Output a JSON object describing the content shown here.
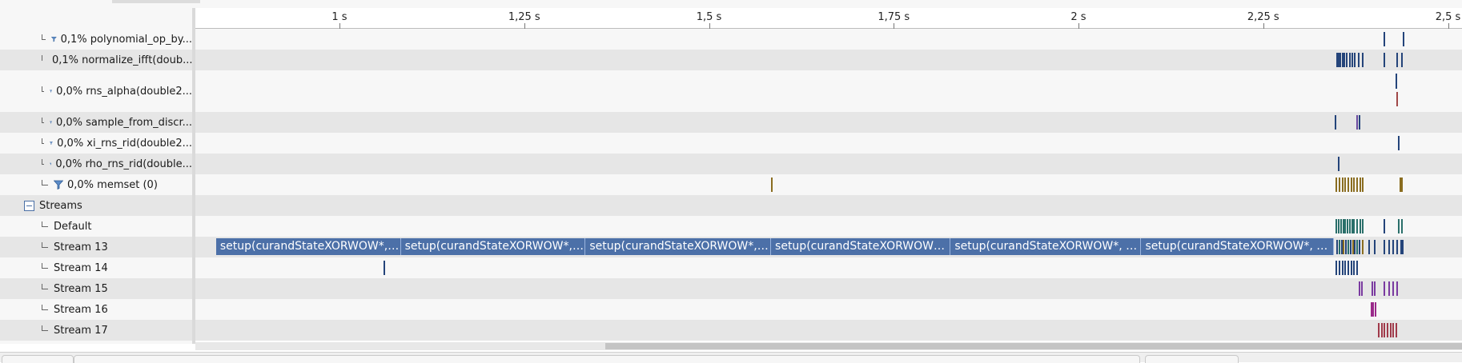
{
  "timeline": {
    "ticks": [
      {
        "label": "1 s",
        "t": 1.0
      },
      {
        "label": "1,25 s",
        "t": 1.25
      },
      {
        "label": "1,5 s",
        "t": 1.5
      },
      {
        "label": "1,75 s",
        "t": 1.75
      },
      {
        "label": "2 s",
        "t": 2.0
      },
      {
        "label": "2,25 s",
        "t": 2.25
      },
      {
        "label": "2,5 s",
        "t": 2.5
      }
    ]
  },
  "rows": [
    {
      "kind": "kernel",
      "label": "0,1% polynomial_op_by...",
      "marks": [
        {
          "t": 2.4125,
          "color": "#24447a"
        },
        {
          "t": 2.4385,
          "color": "#24447a"
        }
      ]
    },
    {
      "kind": "kernel",
      "label": "0,1% normalize_ifft(doub...",
      "marks": [
        {
          "t": 2.349,
          "color": "#24447a"
        },
        {
          "t": 2.351,
          "color": "#24447a"
        },
        {
          "t": 2.353,
          "color": "#24447a"
        },
        {
          "t": 2.356,
          "color": "#24447a"
        },
        {
          "t": 2.359,
          "color": "#24447a"
        },
        {
          "t": 2.362,
          "color": "#24447a"
        },
        {
          "t": 2.366,
          "color": "#24447a"
        },
        {
          "t": 2.369,
          "color": "#24447a"
        },
        {
          "t": 2.373,
          "color": "#24447a"
        },
        {
          "t": 2.378,
          "color": "#24447a"
        },
        {
          "t": 2.383,
          "color": "#24447a"
        },
        {
          "t": 2.4125,
          "color": "#24447a"
        },
        {
          "t": 2.43,
          "color": "#24447a"
        },
        {
          "t": 2.437,
          "color": "#24447a"
        }
      ]
    },
    {
      "kind": "kernel",
      "label": "0,0% rns_alpha(double2...",
      "marks": [
        {
          "t": 2.4295,
          "color": "#24447a"
        },
        {
          "t": 2.4298,
          "color": "#a04848"
        }
      ]
    },
    {
      "kind": "kernel",
      "label": "0,0% sample_from_discr...",
      "marks": [
        {
          "t": 2.347,
          "color": "#24447a"
        },
        {
          "t": 2.376,
          "color": "#6a4aa0"
        },
        {
          "t": 2.379,
          "color": "#24447a"
        }
      ]
    },
    {
      "kind": "kernel",
      "label": "0,0% xi_rns_rid(double2...",
      "marks": [
        {
          "t": 2.432,
          "color": "#24447a"
        }
      ]
    },
    {
      "kind": "kernel",
      "label": "0,0% rho_rns_rid(double...",
      "marks": [
        {
          "t": 2.351,
          "color": "#24447a"
        }
      ]
    },
    {
      "kind": "kernel",
      "label": "0,0% memset (0)",
      "marks": [
        {
          "t": 1.584,
          "color": "#8a6d20"
        },
        {
          "t": 2.348,
          "color": "#8a6d20"
        },
        {
          "t": 2.352,
          "color": "#8a6d20"
        },
        {
          "t": 2.356,
          "color": "#8a6d20"
        },
        {
          "t": 2.36,
          "color": "#8a6d20"
        },
        {
          "t": 2.364,
          "color": "#8a6d20"
        },
        {
          "t": 2.368,
          "color": "#8a6d20"
        },
        {
          "t": 2.372,
          "color": "#8a6d20"
        },
        {
          "t": 2.376,
          "color": "#8a6d20"
        },
        {
          "t": 2.38,
          "color": "#8a6d20"
        },
        {
          "t": 2.384,
          "color": "#8a6d20"
        },
        {
          "t": 2.434,
          "color": "#8a6d20"
        },
        {
          "t": 2.437,
          "color": "#8a6d20"
        }
      ]
    },
    {
      "kind": "group",
      "label": "Streams",
      "marks": []
    },
    {
      "kind": "stream",
      "label": "Default",
      "marks": [
        {
          "t": 2.348,
          "color": "#2a6f6a"
        },
        {
          "t": 2.351,
          "color": "#2a6f6a"
        },
        {
          "t": 2.354,
          "color": "#2a6f6a"
        },
        {
          "t": 2.357,
          "color": "#2a6f6a"
        },
        {
          "t": 2.36,
          "color": "#2a6f6a"
        },
        {
          "t": 2.363,
          "color": "#2a6f6a"
        },
        {
          "t": 2.366,
          "color": "#2a6f6a"
        },
        {
          "t": 2.369,
          "color": "#2a6f6a"
        },
        {
          "t": 2.372,
          "color": "#2a6f6a"
        },
        {
          "t": 2.376,
          "color": "#2a6f6a"
        },
        {
          "t": 2.38,
          "color": "#2a6f6a"
        },
        {
          "t": 2.384,
          "color": "#2a6f6a"
        },
        {
          "t": 2.413,
          "color": "#24447a"
        },
        {
          "t": 2.432,
          "color": "#2a6f6a"
        },
        {
          "t": 2.437,
          "color": "#2a6f6a"
        }
      ]
    },
    {
      "kind": "stream",
      "label": "Stream 13",
      "kernels": [
        {
          "label": "setup(curandStateXORWOW*, u...",
          "t0": 0.833,
          "t1": 1.083
        },
        {
          "label": "setup(curandStateXORWOW*, u...",
          "t0": 1.083,
          "t1": 1.333
        },
        {
          "label": "setup(curandStateXORWOW*, u...",
          "t0": 1.333,
          "t1": 1.584
        },
        {
          "label": "setup(curandStateXORWOW*, ...",
          "t0": 1.584,
          "t1": 1.827
        },
        {
          "label": "setup(curandStateXORWOW*, un...",
          "t0": 1.827,
          "t1": 2.085
        },
        {
          "label": "setup(curandStateXORWOW*, un...",
          "t0": 2.085,
          "t1": 2.346
        }
      ],
      "marks": [
        {
          "t": 2.349,
          "color": "#24447a"
        },
        {
          "t": 2.352,
          "color": "#2a6f6a"
        },
        {
          "t": 2.355,
          "color": "#24447a"
        },
        {
          "t": 2.358,
          "color": "#8a6d20"
        },
        {
          "t": 2.361,
          "color": "#24447a"
        },
        {
          "t": 2.364,
          "color": "#2a6f6a"
        },
        {
          "t": 2.367,
          "color": "#24447a"
        },
        {
          "t": 2.37,
          "color": "#8a6d20"
        },
        {
          "t": 2.373,
          "color": "#24447a"
        },
        {
          "t": 2.376,
          "color": "#2a6f6a"
        },
        {
          "t": 2.379,
          "color": "#24447a"
        },
        {
          "t": 2.383,
          "color": "#8a6d20"
        },
        {
          "t": 2.392,
          "color": "#24447a"
        },
        {
          "t": 2.4,
          "color": "#24447a"
        },
        {
          "t": 2.413,
          "color": "#24447a"
        },
        {
          "t": 2.419,
          "color": "#24447a"
        },
        {
          "t": 2.425,
          "color": "#24447a"
        },
        {
          "t": 2.43,
          "color": "#24447a"
        },
        {
          "t": 2.435,
          "color": "#24447a"
        },
        {
          "t": 2.438,
          "color": "#24447a"
        }
      ]
    },
    {
      "kind": "stream",
      "label": "Stream 14",
      "marks": [
        {
          "t": 1.06,
          "color": "#24447a"
        },
        {
          "t": 2.348,
          "color": "#24447a"
        },
        {
          "t": 2.352,
          "color": "#24447a"
        },
        {
          "t": 2.356,
          "color": "#24447a"
        },
        {
          "t": 2.36,
          "color": "#24447a"
        },
        {
          "t": 2.364,
          "color": "#24447a"
        },
        {
          "t": 2.368,
          "color": "#24447a"
        },
        {
          "t": 2.372,
          "color": "#24447a"
        },
        {
          "t": 2.376,
          "color": "#24447a"
        }
      ]
    },
    {
      "kind": "stream",
      "label": "Stream 15",
      "marks": [
        {
          "t": 2.379,
          "color": "#7a3aa0"
        },
        {
          "t": 2.382,
          "color": "#7a3aa0"
        },
        {
          "t": 2.396,
          "color": "#7a3aa0"
        },
        {
          "t": 2.4,
          "color": "#7a3aa0"
        },
        {
          "t": 2.413,
          "color": "#7a3aa0"
        },
        {
          "t": 2.419,
          "color": "#7a3aa0"
        },
        {
          "t": 2.425,
          "color": "#7a3aa0"
        },
        {
          "t": 2.43,
          "color": "#7a3aa0"
        }
      ]
    },
    {
      "kind": "stream",
      "label": "Stream 16",
      "marks": [
        {
          "t": 2.395,
          "color": "#9a2a8a"
        },
        {
          "t": 2.398,
          "color": "#9a2a8a"
        },
        {
          "t": 2.401,
          "color": "#9a2a8a"
        }
      ]
    },
    {
      "kind": "stream",
      "label": "Stream 17",
      "marks": [
        {
          "t": 2.405,
          "color": "#a03a4a"
        },
        {
          "t": 2.409,
          "color": "#a03a4a"
        },
        {
          "t": 2.413,
          "color": "#a03a4a"
        },
        {
          "t": 2.417,
          "color": "#a03a4a"
        },
        {
          "t": 2.421,
          "color": "#a03a4a"
        },
        {
          "t": 2.425,
          "color": "#a03a4a"
        },
        {
          "t": 2.429,
          "color": "#a03a4a"
        }
      ]
    }
  ]
}
